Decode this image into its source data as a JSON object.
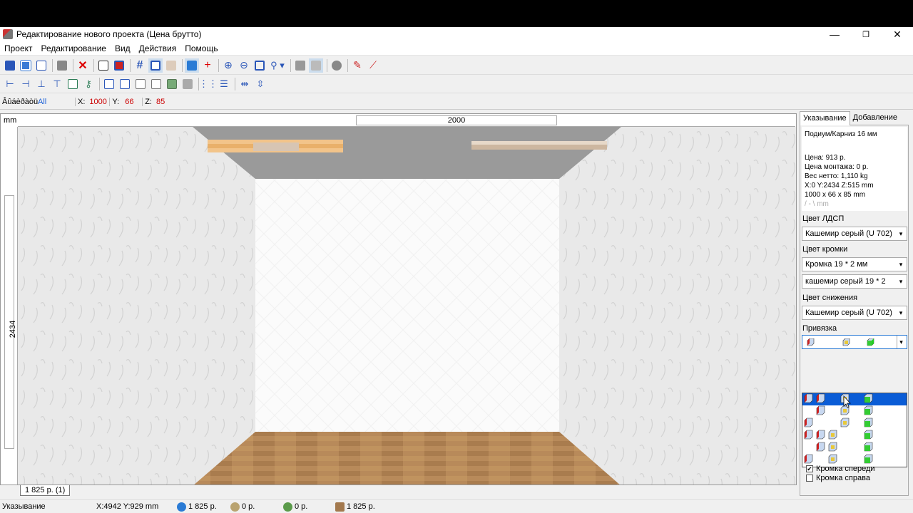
{
  "window": {
    "title": "Редактирование нового проекта (Цена брутто)",
    "minimize": "—",
    "restore": "❐",
    "close": "✕"
  },
  "menu": [
    "Проект",
    "Редактирование",
    "Вид",
    "Действия",
    "Помощь"
  ],
  "coords": {
    "mode_label": "Âûáèðàòü",
    "mode_value": "All",
    "x_label": "X:",
    "x_value": "1000",
    "y_label": "Y:",
    "y_value": "66",
    "z_label": "Z:",
    "z_value": "85"
  },
  "canvas": {
    "unit": "mm",
    "width_label": "2000",
    "height_label": "2434"
  },
  "sheet_tab": "1 825 р. (1)",
  "panel": {
    "tabs": [
      "Указывание",
      "Добавление"
    ],
    "item_name": "Подиум/Карниз 16 мм",
    "price": "Цена:  913 р.",
    "install": "Цена монтажа:  0 р.",
    "weight": "Вес нетто:  1,110 kg",
    "position": "X:0  Y:2434  Z:515 mm",
    "size": "1000 x 66 x 85 mm",
    "angle": "/ - \\ mm",
    "ldsp_label": "Цвет ЛДСП",
    "ldsp_value": "Кашемир серый (U 702)",
    "edge_label": "Цвет кромки",
    "edge_value1": "Кромка 19 * 2 мм",
    "edge_value2": "кашемир серый 19 * 2",
    "lower_label": "Цвет снижения",
    "lower_value": "Кашемир серый (U 702)",
    "snap_label": "Привязка",
    "check_front": "Кромка спереди",
    "check_right": "Кромка справа"
  },
  "status": {
    "mode": "Указывание",
    "xy": "X:4942  Y:929  mm",
    "total": "1 825 р.",
    "item1": "0 р.",
    "item2": "0 р.",
    "item3": "1 825 р."
  }
}
